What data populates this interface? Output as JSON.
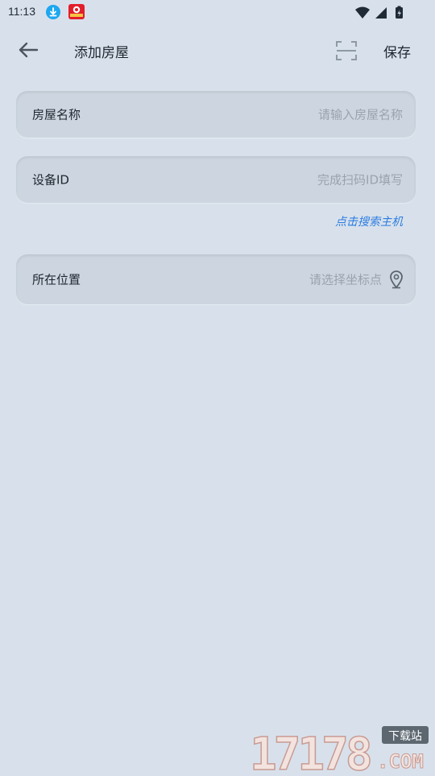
{
  "status_bar": {
    "time": "11:13"
  },
  "header": {
    "title": "添加房屋",
    "save_label": "保存"
  },
  "form": {
    "house_name": {
      "label": "房屋名称",
      "placeholder": "请输入房屋名称"
    },
    "device_id": {
      "label": "设备ID",
      "placeholder": "完成扫码ID填写"
    },
    "search_host_link": "点击搜索主机",
    "location": {
      "label": "所在位置",
      "placeholder": "请选择坐标点"
    }
  },
  "watermark": {
    "number": "17178",
    "badge": "下载站",
    "suffix": ".COM"
  },
  "icons": {
    "back": "arrow-left-icon",
    "scan": "scan-icon",
    "location": "map-pin-icon"
  },
  "colors": {
    "background": "#d8e1eb",
    "field_background": "#cdd6e0",
    "link": "#2e7de1",
    "placeholder": "#9aa3ad"
  }
}
